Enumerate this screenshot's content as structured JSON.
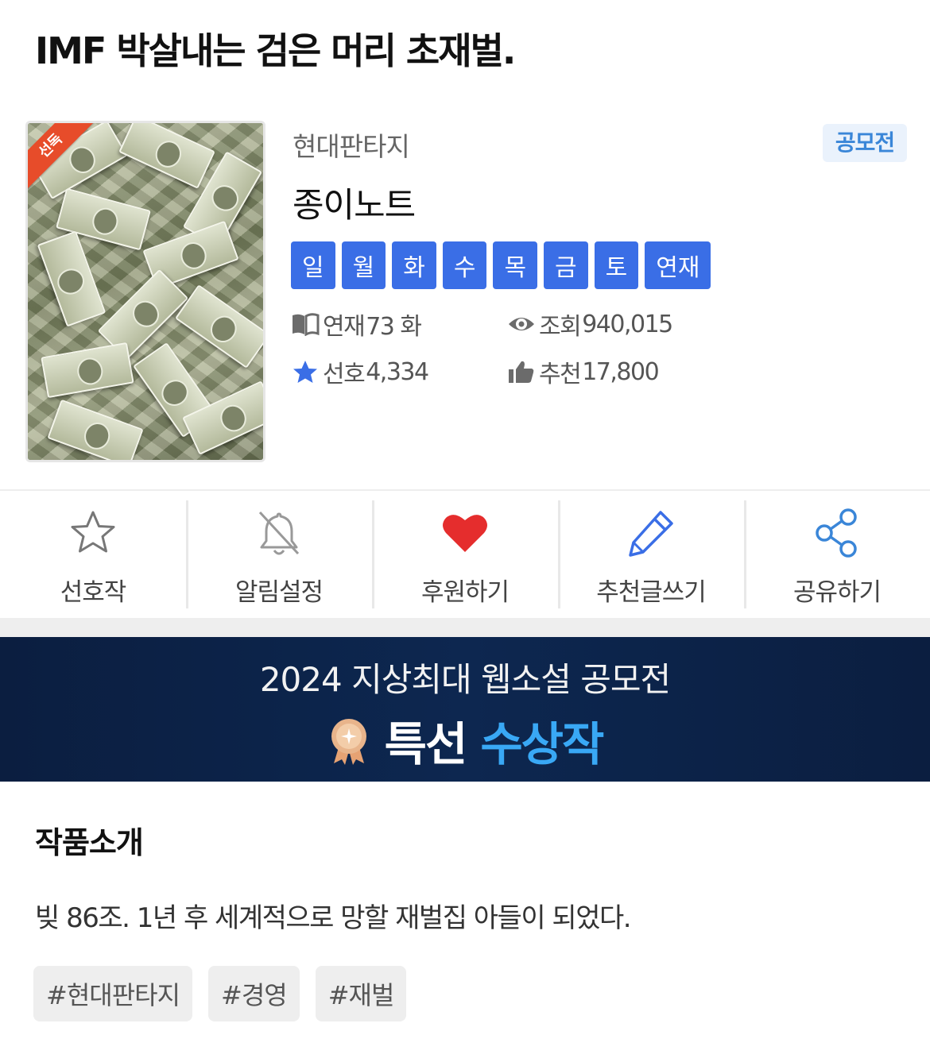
{
  "novel": {
    "title": "IMF 박살내는 검은 머리 초재벌.",
    "badge": "선독",
    "genre": "현대판타지",
    "contest_tag": "공모전",
    "author": "종이노트",
    "days": [
      "일",
      "월",
      "화",
      "수",
      "목",
      "금",
      "토",
      "연재"
    ]
  },
  "stats": {
    "episodes_label": "연재",
    "episodes_value": "73 화",
    "views_label": "조회",
    "views_value": "940,015",
    "favorites_label": "선호",
    "favorites_value": "4,334",
    "recommend_label": "추천",
    "recommend_value": "17,800"
  },
  "actions": {
    "favorite": "선호작",
    "notify": "알림설정",
    "support": "후원하기",
    "review": "추천글쓰기",
    "share": "공유하기"
  },
  "banner": {
    "line1": "2024 지상최대 웹소설 공모전",
    "award_word": "특선",
    "award_highlight": "수상작"
  },
  "intro": {
    "heading": "작품소개",
    "text": "빚 86조. 1년 후 세계적으로 망할 재벌집 아들이 되었다.",
    "tags": [
      "#현대판타지",
      "#경영",
      "#재벌"
    ]
  },
  "colors": {
    "day_blue": "#3a6ee6",
    "badge_red": "#e74c2a",
    "heart_red": "#e52d2d",
    "pencil_blue": "#3a6ee6",
    "share_blue": "#3a86d8",
    "banner_navy": "#0d2750",
    "award_blue": "#39a8f5"
  }
}
